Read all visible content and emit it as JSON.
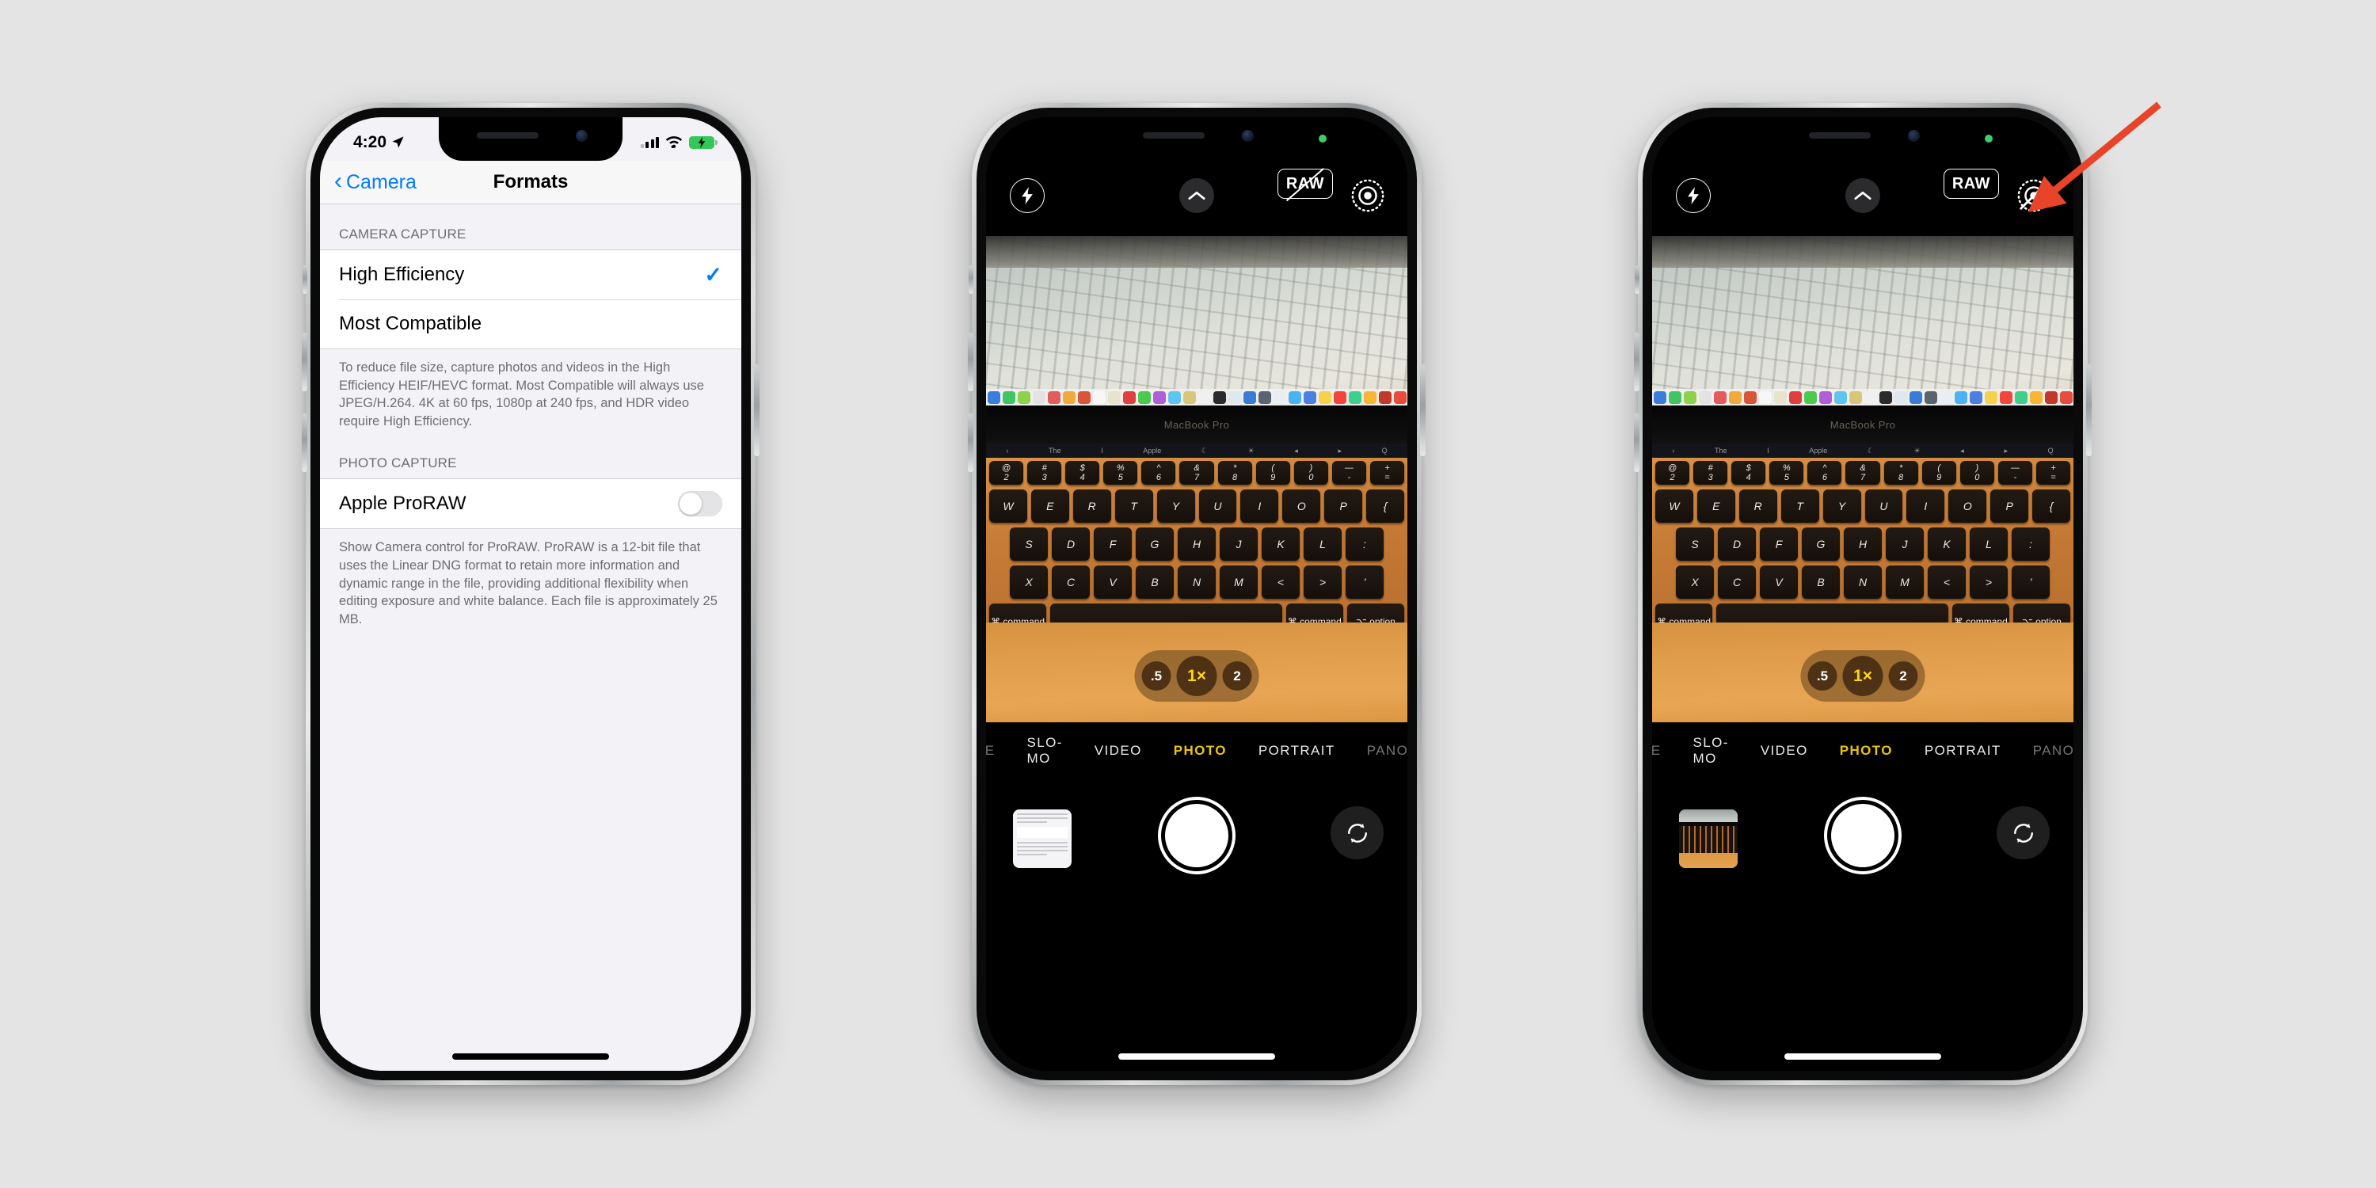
{
  "background_color": "#e4e4e4",
  "annotation": {
    "arrow_color": "#e8442a",
    "points_to": "raw-button-phone-3"
  },
  "phone1": {
    "name": "iPhone Settings - Camera Formats",
    "status_bar": {
      "time": "4:20",
      "location_icon": "location-arrow-icon",
      "cellular_icon": "cellular-bars-icon",
      "wifi_icon": "wifi-icon",
      "battery_icon": "battery-charging-icon",
      "battery_color": "#34c759"
    },
    "nav": {
      "back_label": "Camera",
      "back_chevron": "‹",
      "title": "Formats"
    },
    "sections": [
      {
        "header": "CAMERA CAPTURE",
        "rows": [
          {
            "label": "High Efficiency",
            "checked": true,
            "check_glyph": "✓"
          },
          {
            "label": "Most Compatible",
            "checked": false,
            "check_glyph": ""
          }
        ],
        "footer": "To reduce file size, capture photos and videos in the High Efficiency HEIF/HEVC format. Most Compatible will always use JPEG/H.264. 4K at 60 fps, 1080p at 240 fps, and HDR video require High Efficiency."
      },
      {
        "header": "PHOTO CAPTURE",
        "rows": [
          {
            "label": "Apple ProRAW",
            "toggle": true,
            "toggle_on": false
          }
        ],
        "footer": "Show Camera control for ProRAW. ProRAW is a 12-bit file that uses the Linear DNG format to retain more information and dynamic range in the file, providing additional flexibility when editing exposure and white balance. Each file is approximately 25 MB."
      }
    ],
    "accent_color": "#007aff"
  },
  "phone2": {
    "name": "Camera app - ProRAW off",
    "recording_indicator": "green-privacy-dot",
    "top_controls": {
      "flash": {
        "icon": "flash-bolt-icon",
        "label": ""
      },
      "chevron": {
        "icon": "chevron-up-icon"
      },
      "raw": {
        "label": "RAW",
        "state": "off",
        "slashed": true
      },
      "live_photo": {
        "icon": "live-photo-icon",
        "state": "on",
        "slashed": false
      }
    },
    "zoom_options": [
      {
        "label": ".5",
        "active": false
      },
      {
        "label": "1×",
        "active": true
      },
      {
        "label": "2",
        "active": false
      }
    ],
    "modes": [
      {
        "label": "E",
        "active": false,
        "edge": true
      },
      {
        "label": "SLO-MO",
        "active": false
      },
      {
        "label": "VIDEO",
        "active": false
      },
      {
        "label": "PHOTO",
        "active": true
      },
      {
        "label": "PORTRAIT",
        "active": false
      },
      {
        "label": "PANO",
        "active": false,
        "edge": true
      }
    ],
    "bottom": {
      "thumbnail": "settings-screenshot-thumbnail",
      "shutter": "shutter-button",
      "flip": "flip-camera-icon"
    },
    "preview": {
      "subject": "MacBook Pro on desk",
      "laptop_label": "MacBook Pro",
      "touchbar_items": [
        "›",
        "The",
        "I",
        "Apple",
        "☾",
        "☀",
        "◂",
        "▸",
        "Q"
      ],
      "keyboard_rows": [
        [
          "@\n2",
          "#\n3",
          "$\n4",
          "%\n5",
          "^\n6",
          "&\n7",
          "*\n8",
          "(\n9",
          ")\n0",
          "—\n-",
          "+\n="
        ],
        [
          "W",
          "E",
          "R",
          "T",
          "Y",
          "U",
          "I",
          "O",
          "P",
          "{"
        ],
        [
          "S",
          "D",
          "F",
          "G",
          "H",
          "J",
          "K",
          "L",
          ":"
        ],
        [
          "X",
          "C",
          "V",
          "B",
          "N",
          "M",
          "<",
          ">",
          "’"
        ],
        [
          "⌘ command",
          "",
          "⌘ command",
          "⌥ option"
        ]
      ]
    }
  },
  "phone3": {
    "name": "Camera app - ProRAW on",
    "recording_indicator": "green-privacy-dot",
    "top_controls": {
      "flash": {
        "icon": "flash-bolt-icon"
      },
      "chevron": {
        "icon": "chevron-up-icon"
      },
      "raw": {
        "label": "RAW",
        "state": "on",
        "slashed": false
      },
      "live_photo": {
        "icon": "live-photo-icon",
        "state": "off",
        "slashed": true
      }
    },
    "zoom_options": [
      {
        "label": ".5",
        "active": false
      },
      {
        "label": "1×",
        "active": true
      },
      {
        "label": "2",
        "active": false
      }
    ],
    "modes": [
      {
        "label": "E",
        "active": false,
        "edge": true
      },
      {
        "label": "SLO-MO",
        "active": false
      },
      {
        "label": "VIDEO",
        "active": false
      },
      {
        "label": "PHOTO",
        "active": true
      },
      {
        "label": "PORTRAIT",
        "active": false
      },
      {
        "label": "PANO",
        "active": false,
        "edge": true
      }
    ],
    "bottom": {
      "thumbnail": "macbook-photo-thumbnail",
      "shutter": "shutter-button",
      "flip": "flip-camera-icon"
    },
    "preview": {
      "subject": "MacBook Pro on desk",
      "laptop_label": "MacBook Pro"
    }
  },
  "dock_colors": [
    "#3b7ddd",
    "#41c463",
    "#8ed14a",
    "#e3e3e3",
    "#e35b5b",
    "#f0a93c",
    "#d8553c",
    "#f7f7f7",
    "#e9e2cc",
    "#e0403d",
    "#4cc951",
    "#b05fd6",
    "#5ec4f0",
    "#d8c77a",
    "#f0f0f0",
    "#2b2b2d",
    "#dfe7ef",
    "#3a7bd5",
    "#5a6470",
    "#e9eef2",
    "#4ab3f4",
    "#4c7fe0",
    "#f6d14a",
    "#f0463c",
    "#3ecf8e",
    "#f7b733",
    "#c0392b",
    "#e74c3c",
    "#2f8ee0",
    "#efefef",
    "#3498db",
    "#f2a93b",
    "#ef4c3c",
    "#2dbd6e",
    "#1a9cd8",
    "#34495e"
  ]
}
